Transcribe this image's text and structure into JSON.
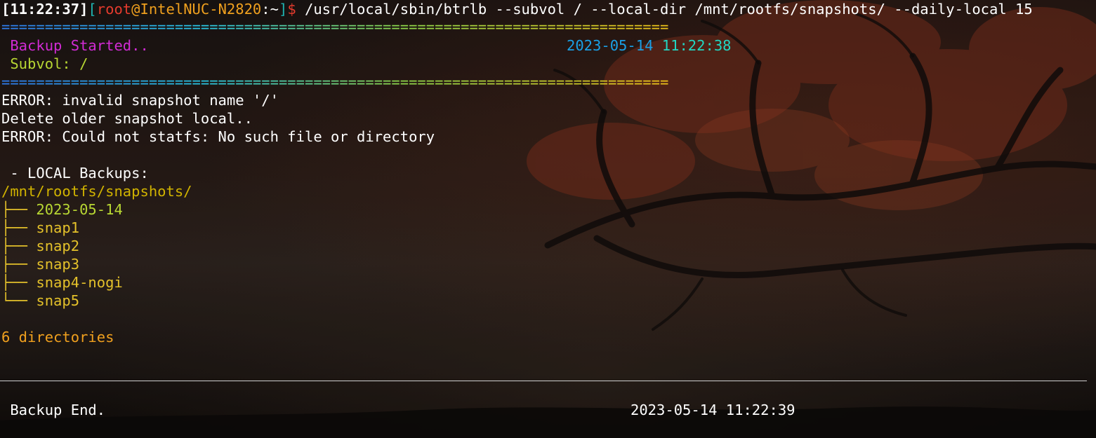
{
  "prompt": {
    "time": "[11:22:37]",
    "bracket_open": "[",
    "user": "root",
    "at": "@",
    "host": "IntelNUC-N2820",
    "colon": ":",
    "path": "~",
    "bracket_close": "]",
    "dollar": "$",
    "command": " /usr/local/sbin/btrlb --subvol / --local-dir /mnt/rootfs/snapshots/ --daily-local 15"
  },
  "rule_text": "=============================================================================",
  "header": {
    "started": " Backup Started..",
    "started_timestamp_date": "2023-05-14",
    "started_timestamp_time": "11:22:38",
    "subvol": " Subvol: /"
  },
  "messages": [
    "ERROR: invalid snapshot name '/'",
    "Delete older snapshot local..",
    "ERROR: Could not statfs: No such file or directory"
  ],
  "local_backups_label": " - LOCAL Backups:",
  "snapshot_dir": "/mnt/rootfs/snapshots/",
  "tree": [
    {
      "branch": "├── ",
      "name": "2023-05-14"
    },
    {
      "branch": "├── ",
      "name": "snap1"
    },
    {
      "branch": "├── ",
      "name": "snap2"
    },
    {
      "branch": "├── ",
      "name": "snap3"
    },
    {
      "branch": "├── ",
      "name": "snap4-nogi"
    },
    {
      "branch": "└── ",
      "name": "snap5"
    }
  ],
  "summary": "6 directories",
  "footer": {
    "end_label": " Backup End.",
    "end_timestamp": "2023-05-14 11:22:39"
  },
  "colors": {
    "prompt_user": "#e53b2d",
    "prompt_host": "#f0a01e",
    "started": "#d12bd4",
    "subvol": "#b8d733",
    "timestamp_date": "#1aa0e6",
    "timestamp_time": "#22d6c3",
    "tree_dir": "#d1b300"
  }
}
